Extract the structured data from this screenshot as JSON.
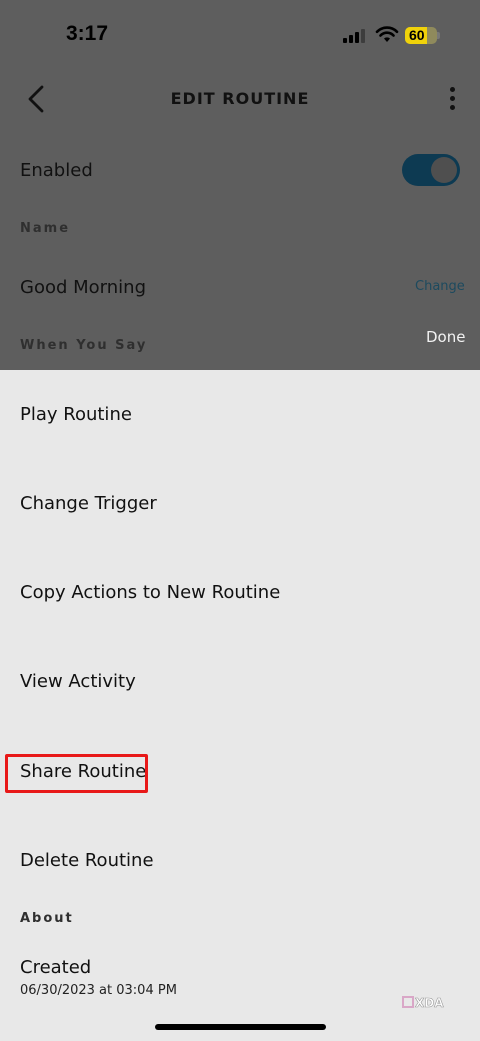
{
  "status_bar": {
    "time": "3:17",
    "battery": "60"
  },
  "header": {
    "title": "EDIT ROUTINE"
  },
  "routine": {
    "enabled_label": "Enabled",
    "enabled": true,
    "name_section": "Name",
    "name_value": "Good Morning",
    "change_label": "Change",
    "when_section": "When You Say",
    "done_label": "Done"
  },
  "sheet": {
    "items": [
      {
        "label": "Play Routine"
      },
      {
        "label": "Change Trigger"
      },
      {
        "label": "Copy Actions to New Routine"
      },
      {
        "label": "View Activity"
      },
      {
        "label": "Share Routine"
      },
      {
        "label": "Delete Routine"
      }
    ],
    "about_section": "About",
    "created_label": "Created",
    "created_value": "06/30/2023 at 03:04 PM"
  },
  "colors": {
    "toggle_on": "#0d3a52",
    "highlight": "#e81818",
    "battery": "#f0d20a"
  },
  "watermark": "XDA"
}
